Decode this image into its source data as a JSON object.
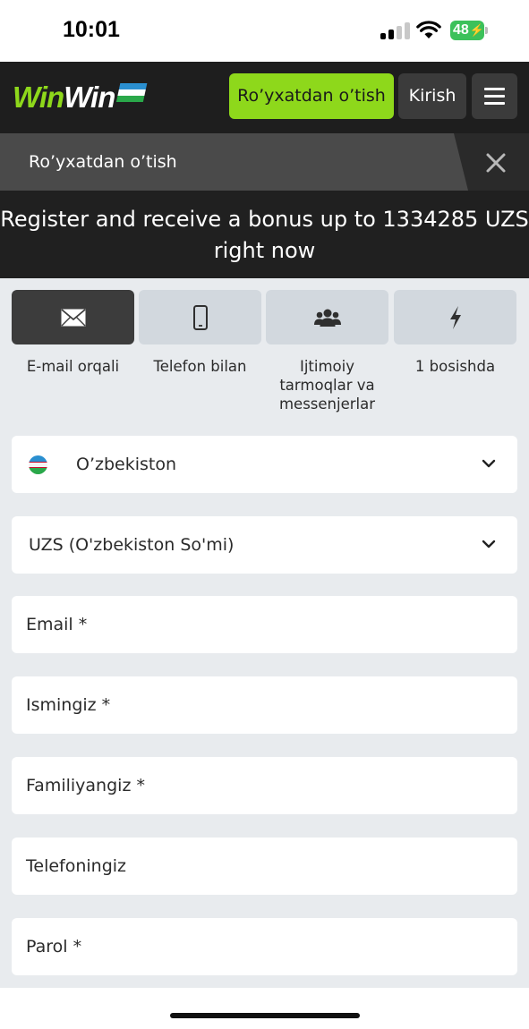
{
  "status_bar": {
    "time": "10:01",
    "battery": "48"
  },
  "header": {
    "logo_part1": "Win",
    "logo_part2": "Win",
    "register_label": "Ro’yxatdan o’tish",
    "login_label": "Kirish",
    "menu_icon": "hamburger-icon"
  },
  "sub_header": {
    "title": "Ro’yxatdan o’tish",
    "close_icon": "close-icon"
  },
  "banner": {
    "text": "Register and receive a bonus up to 1334285 UZS right now"
  },
  "methods": [
    {
      "label": "E-mail orqali",
      "icon": "envelope-icon",
      "active": true
    },
    {
      "label": "Telefon bilan",
      "icon": "phone-icon",
      "active": false
    },
    {
      "label": "Ijtimoiy tarmoqlar va messenjerlar",
      "icon": "people-icon",
      "active": false
    },
    {
      "label": "1 bosishda",
      "icon": "lightning-icon",
      "active": false
    }
  ],
  "form": {
    "country": "O’zbekiston",
    "currency": "UZS (O'zbekiston So'mi)",
    "email_placeholder": "Email  *",
    "name_placeholder": "Ismingiz  *",
    "surname_placeholder": "Familiyangiz  *",
    "phone_placeholder": "Telefoningiz",
    "password_placeholder": "Parol  *"
  },
  "colors": {
    "accent_green": "#8ed81b",
    "header_bg": "#1e1e1e",
    "form_bg": "#e8ebee",
    "flag_blue": "#2a8fd0",
    "flag_green": "#2aa84a"
  }
}
